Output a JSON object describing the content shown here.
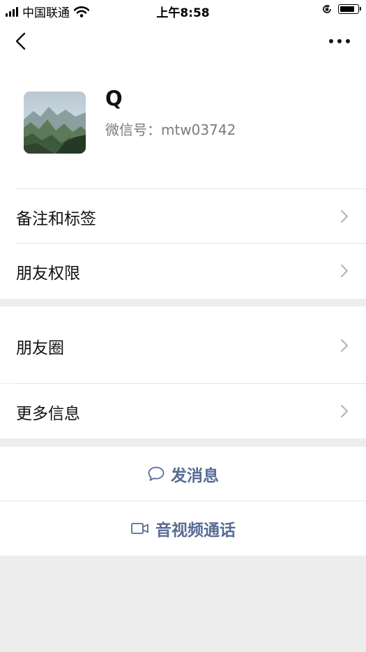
{
  "status_bar": {
    "carrier": "中国联通",
    "time": "上午8:58",
    "battery_level": 0.9
  },
  "nav": {
    "back_icon": "chevron-left-icon",
    "more_icon": "more-dots-icon"
  },
  "profile": {
    "name": "Q",
    "wechat_id": "微信号：mtw03742"
  },
  "rows": {
    "remarks_tags": "备注和标签",
    "friend_permissions": "朋友权限",
    "moments": "朋友圈",
    "more_info": "更多信息"
  },
  "actions": {
    "send_message": "发消息",
    "av_call": "音视频通话"
  },
  "colors": {
    "link": "#576b95",
    "background": "#ededed"
  }
}
